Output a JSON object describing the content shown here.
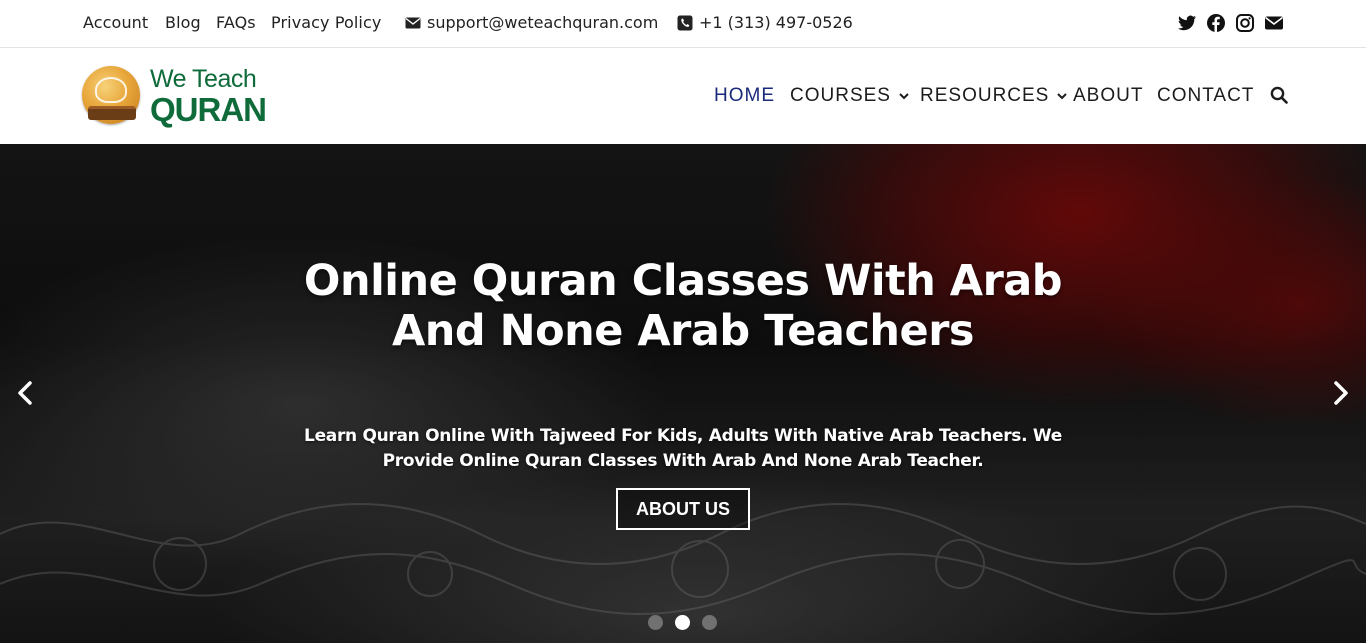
{
  "topbar": {
    "links": [
      "Account",
      "Blog",
      "FAQs",
      "Privacy Policy"
    ],
    "email": "support@weteachquran.com",
    "phone": "+1 (313) 497-0526",
    "social_icons": [
      "twitter-icon",
      "facebook-icon",
      "instagram-icon",
      "envelope-icon"
    ]
  },
  "header": {
    "logo": {
      "line1": "We Teach",
      "line2": "QURAN"
    },
    "nav": [
      {
        "label": "HOME",
        "active": true,
        "dropdown": false
      },
      {
        "label": "COURSES",
        "active": false,
        "dropdown": true
      },
      {
        "label": "RESOURCES",
        "active": false,
        "dropdown": true
      },
      {
        "label": "ABOUT",
        "active": false,
        "dropdown": false
      },
      {
        "label": "CONTACT",
        "active": false,
        "dropdown": false
      }
    ],
    "search_icon": "search-icon"
  },
  "hero": {
    "title": "Online Quran Classes With Arab And None Arab Teachers",
    "subtitle": "Learn Quran Online With Tajweed For Kids, Adults With Native Arab Teachers. We Provide Online Quran Classes With Arab And None Arab Teacher.",
    "button": "ABOUT US",
    "slide_count": 3,
    "active_slide": 2
  },
  "colors": {
    "brand_green": "#0f6b3a",
    "nav_active": "#1a2a7a",
    "hero_red": "#960a0a"
  }
}
